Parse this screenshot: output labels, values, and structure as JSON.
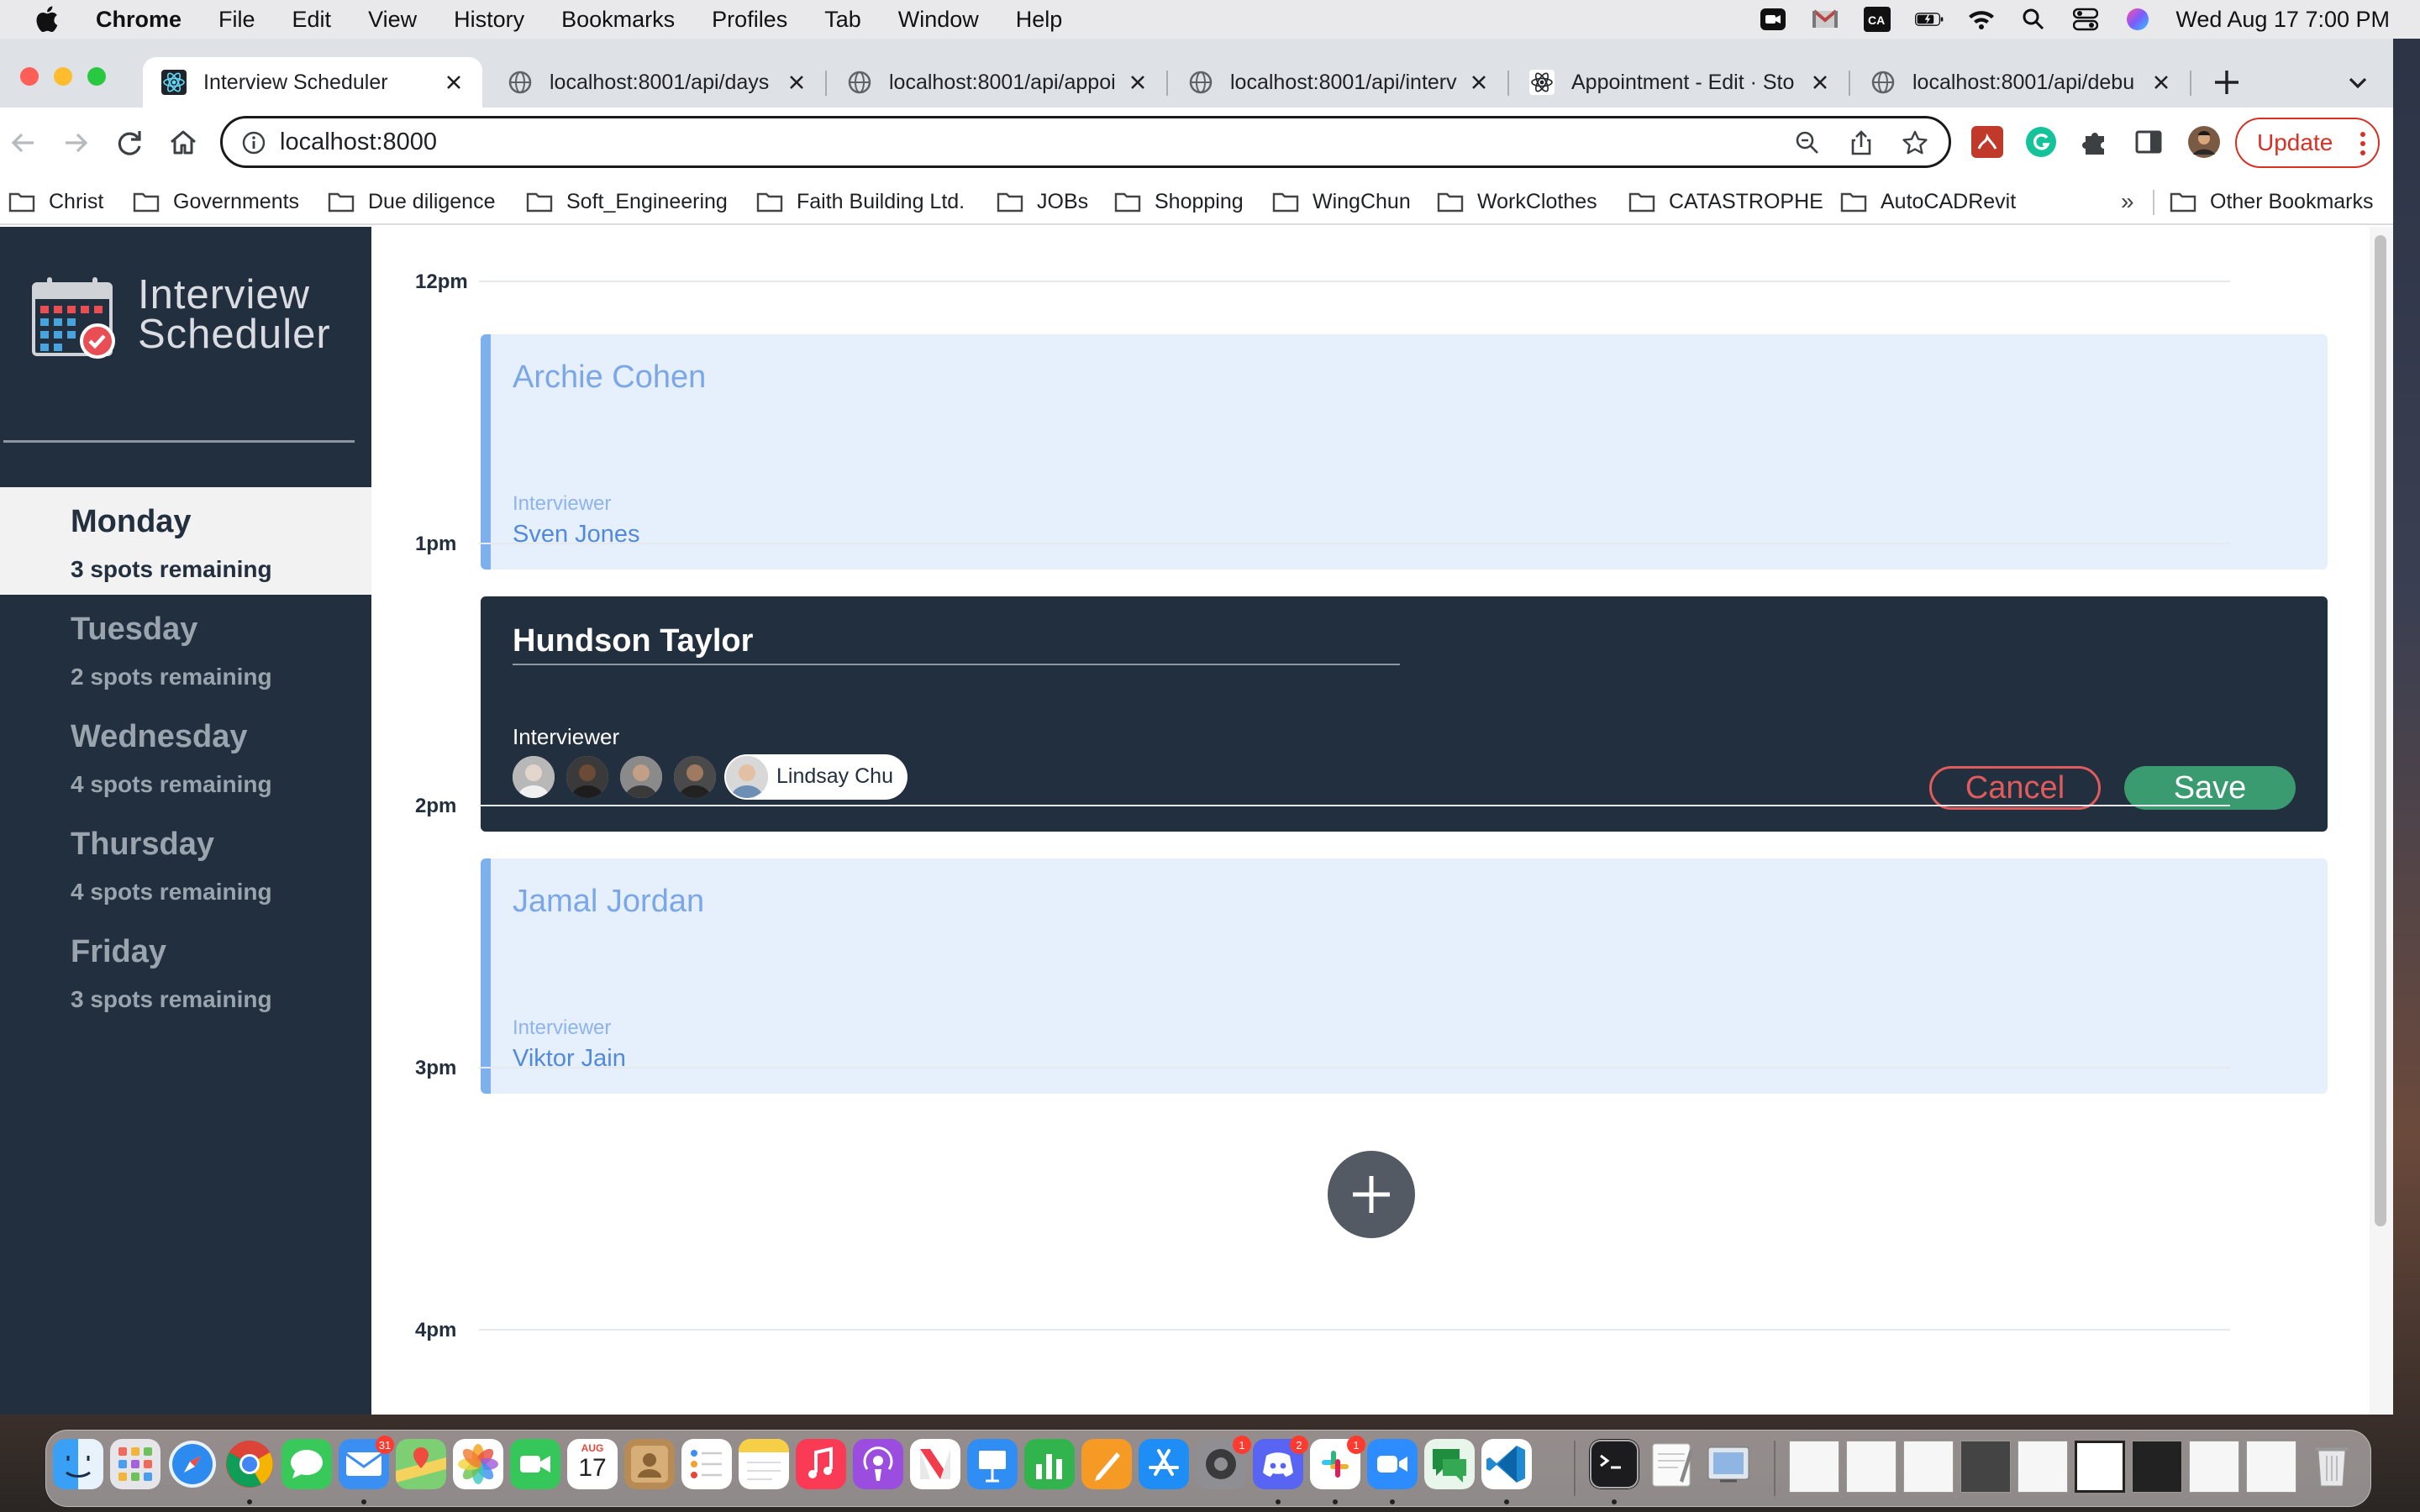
{
  "menubar": {
    "app_name": "Chrome",
    "items": [
      "File",
      "Edit",
      "View",
      "History",
      "Bookmarks",
      "Profiles",
      "Tab",
      "Window",
      "Help"
    ],
    "clock": "Wed Aug 17  7:00 PM",
    "status_icons": [
      "video-icon",
      "gmail-icon",
      "ca-icon",
      "battery-icon",
      "wifi-icon",
      "search-icon",
      "control-center-icon",
      "siri-icon"
    ]
  },
  "tabs": [
    {
      "title": "Interview Scheduler",
      "favicon": "react-icon",
      "active": true
    },
    {
      "title": "localhost:8001/api/days",
      "favicon": "globe-icon",
      "active": false
    },
    {
      "title": "localhost:8001/api/appoi",
      "favicon": "globe-icon",
      "active": false
    },
    {
      "title": "localhost:8001/api/interv",
      "favicon": "globe-icon",
      "active": false
    },
    {
      "title": "Appointment - Edit · Sto",
      "favicon": "react-icon",
      "active": false
    },
    {
      "title": "localhost:8001/api/debu",
      "favicon": "globe-icon",
      "active": false
    }
  ],
  "toolbar": {
    "url": "localhost:8000",
    "update_label": "Update"
  },
  "bookmarks": {
    "items": [
      "Christ",
      "Governments",
      "Due diligence",
      "Soft_Engineering",
      "Faith Building Ltd.",
      "JOBs",
      "Shopping",
      "WingChun",
      "WorkClothes",
      "CATASTROPHE",
      "AutoCADRevit"
    ],
    "more": "»",
    "other": "Other Bookmarks"
  },
  "app": {
    "logo_line1": "Interview",
    "logo_line2": "Scheduler",
    "days": [
      {
        "name": "Monday",
        "spots": "3 spots remaining",
        "selected": true
      },
      {
        "name": "Tuesday",
        "spots": "2 spots remaining",
        "selected": false
      },
      {
        "name": "Wednesday",
        "spots": "4 spots remaining",
        "selected": false
      },
      {
        "name": "Thursday",
        "spots": "4 spots remaining",
        "selected": false
      },
      {
        "name": "Friday",
        "spots": "3 spots remaining",
        "selected": false
      }
    ],
    "hours": [
      "12pm",
      "1pm",
      "2pm",
      "3pm",
      "4pm"
    ],
    "appointments": [
      {
        "student": "Archie Cohen",
        "interviewer_label": "Interviewer",
        "interviewer": "Sven Jones"
      },
      {
        "student": "Jamal Jordan",
        "interviewer_label": "Interviewer",
        "interviewer": "Viktor Jain"
      }
    ],
    "form": {
      "student_value": "Hundson Taylor",
      "interviewer_label": "Interviewer",
      "selected_interviewer": "Lindsay Chu",
      "cancel_label": "Cancel",
      "save_label": "Save"
    }
  },
  "dock": {
    "badges": {
      "mail": "31",
      "discord": "2",
      "slack": "1",
      "settings": "1"
    },
    "calendar_month": "AUG",
    "calendar_day": "17"
  }
}
